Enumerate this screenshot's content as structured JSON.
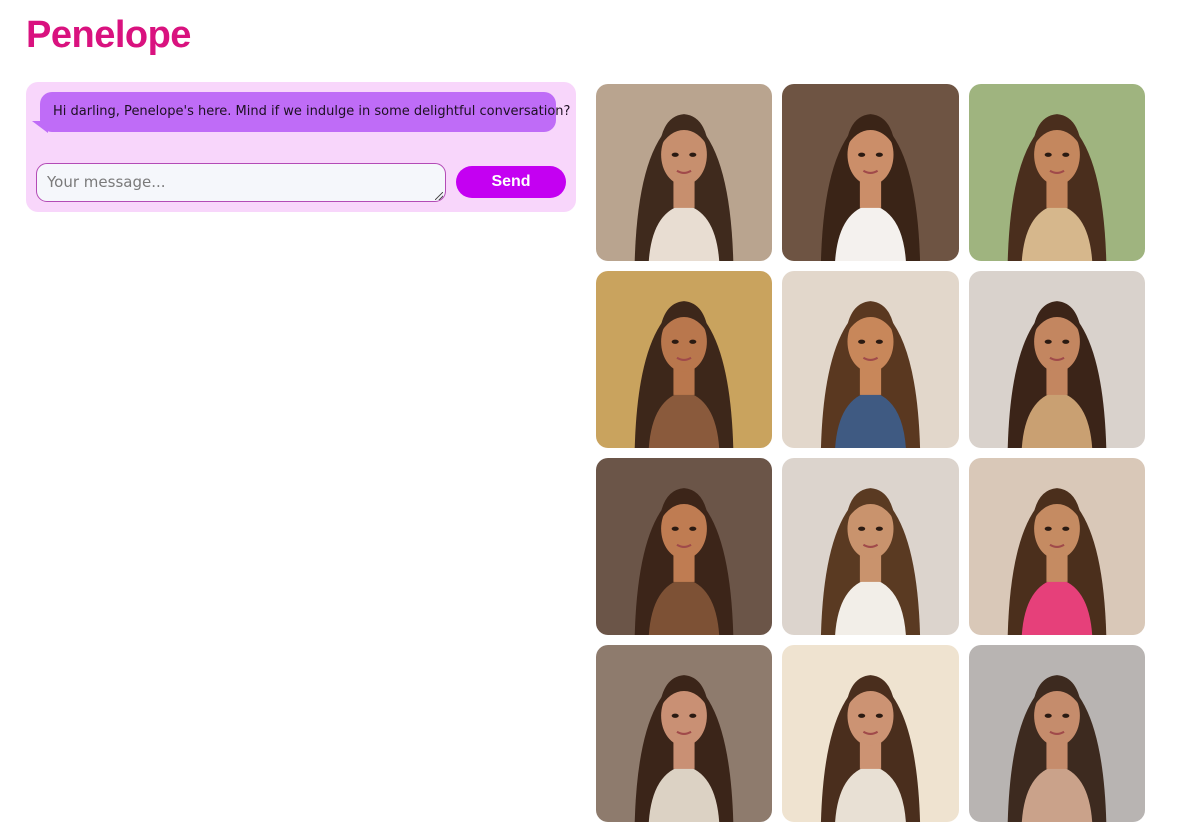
{
  "title": "Penelope",
  "chat": {
    "greeting": "Hi darling, Penelope's here. Mind if we indulge in some delightful conversation?",
    "input_placeholder": "Your message...",
    "send_label": "Send"
  },
  "colors": {
    "brand": "#d9127f",
    "panel": "#f8d6fb",
    "bubble": "#bf6cf7",
    "send": "#c400f2"
  },
  "gallery": [
    {
      "bg": "#b9a48f",
      "hair": "#3f2a1d",
      "skin": "#c78f6e",
      "outfit": "#e8ddd2"
    },
    {
      "bg": "#6e5443",
      "hair": "#3a2417",
      "skin": "#cb8e69",
      "outfit": "#f4f1ee"
    },
    {
      "bg": "#9fb47f",
      "hair": "#4a2e1d",
      "skin": "#c4875e",
      "outfit": "#d6b78c"
    },
    {
      "bg": "#c9a35e",
      "hair": "#3d271a",
      "skin": "#b9774d",
      "outfit": "#8a5a3c"
    },
    {
      "bg": "#e2d7cb",
      "hair": "#5a3820",
      "skin": "#c8875a",
      "outfit": "#3f5a82"
    },
    {
      "bg": "#d9d2cc",
      "hair": "#3b2418",
      "skin": "#c38660",
      "outfit": "#c9a072"
    },
    {
      "bg": "#6b5548",
      "hair": "#3c2519",
      "skin": "#bf7c52",
      "outfit": "#7d5135"
    },
    {
      "bg": "#dcd4cd",
      "hair": "#5a3a22",
      "skin": "#c9936d",
      "outfit": "#f2eee8"
    },
    {
      "bg": "#d9c8b8",
      "hair": "#4b2f1c",
      "skin": "#c58b62",
      "outfit": "#e6407a"
    },
    {
      "bg": "#8e7b6d",
      "hair": "#3b2519",
      "skin": "#c99074",
      "outfit": "#dcd2c4"
    },
    {
      "bg": "#efe3d0",
      "hair": "#4a2e1d",
      "skin": "#cc9373",
      "outfit": "#e8e0d4"
    },
    {
      "bg": "#b8b4b2",
      "hair": "#3d2a1f",
      "skin": "#c58c6c",
      "outfit": "#caa28a"
    }
  ]
}
